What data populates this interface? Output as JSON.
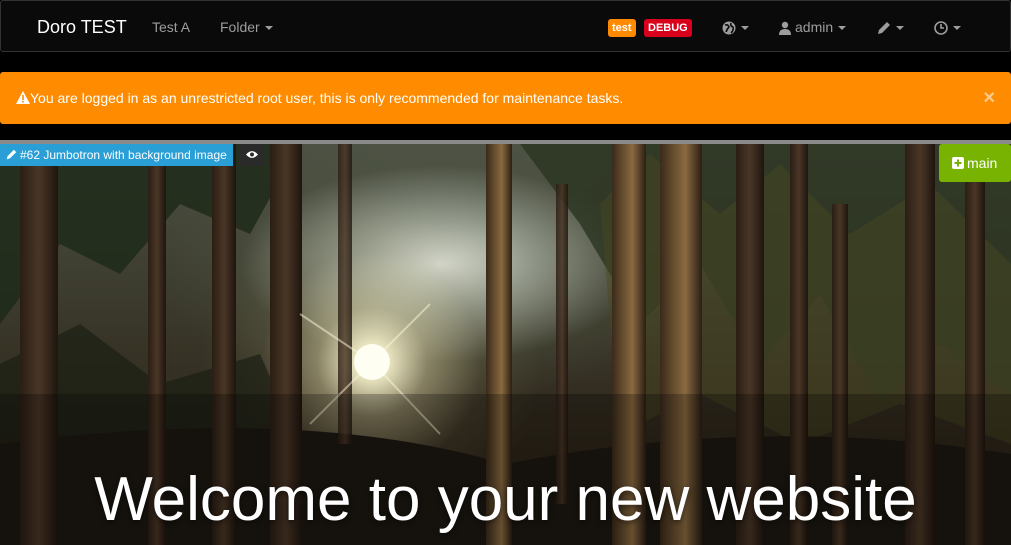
{
  "navbar": {
    "brand": "Doro TEST",
    "items": [
      {
        "label": "Test A"
      },
      {
        "label": "Folder"
      }
    ],
    "badges": {
      "test": "test",
      "debug": "DEBUG"
    },
    "user": "admin",
    "icons": [
      "globe-icon",
      "user-icon",
      "pencil-icon",
      "clock-icon"
    ]
  },
  "alert": {
    "text": "You are logged in as an unrestricted root user, this is only recommended for maintenance tasks.",
    "close": "×"
  },
  "block": {
    "edit_label": "#62 Jumbotron with background image",
    "main_button": "main"
  },
  "jumbotron": {
    "headline": "Welcome to your new website"
  },
  "colors": {
    "navbar_bg": "#0a0a0a",
    "alert_bg": "#ff8c00",
    "badge_test": "#ff8a00",
    "badge_debug": "#d9001b",
    "edit_tag": "#2a9fd6",
    "main_button": "#77b300"
  }
}
